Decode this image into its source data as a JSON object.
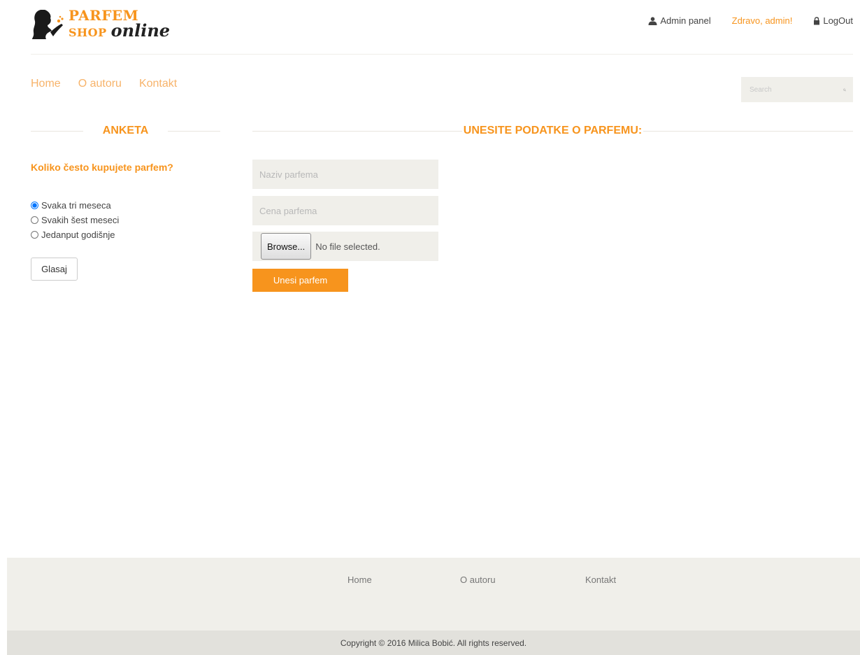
{
  "brand": {
    "line1": "PARFEM",
    "line2": "SHOP",
    "line3": "online",
    "accent_color": "#f7941d"
  },
  "top_links": {
    "admin_panel": "Admin panel",
    "greeting": "Zdravo,  admin!",
    "logout": "LogOut"
  },
  "nav": {
    "items": [
      "Home",
      "O autoru",
      "Kontakt"
    ]
  },
  "search": {
    "placeholder": "Search"
  },
  "poll": {
    "heading": "ANKETA",
    "question": "Koliko često kupujete parfem?",
    "options": [
      "Svaka tri meseca",
      "Svakih šest meseci",
      "Jedanput godišnje"
    ],
    "selected_index": 0,
    "vote_label": "Glasaj"
  },
  "form": {
    "heading": "UNESITE PODATKE O PARFEMU:",
    "name_placeholder": "Naziv parfema",
    "price_placeholder": "Cena parfema",
    "browse_label": "Browse...",
    "file_status": "No file selected.",
    "submit_label": "Unesi parfem"
  },
  "footer": {
    "links": [
      "Home",
      "O autoru",
      "Kontakt"
    ],
    "copyright": "Copyright © 2016 Milica Bobić. All rights reserved."
  }
}
